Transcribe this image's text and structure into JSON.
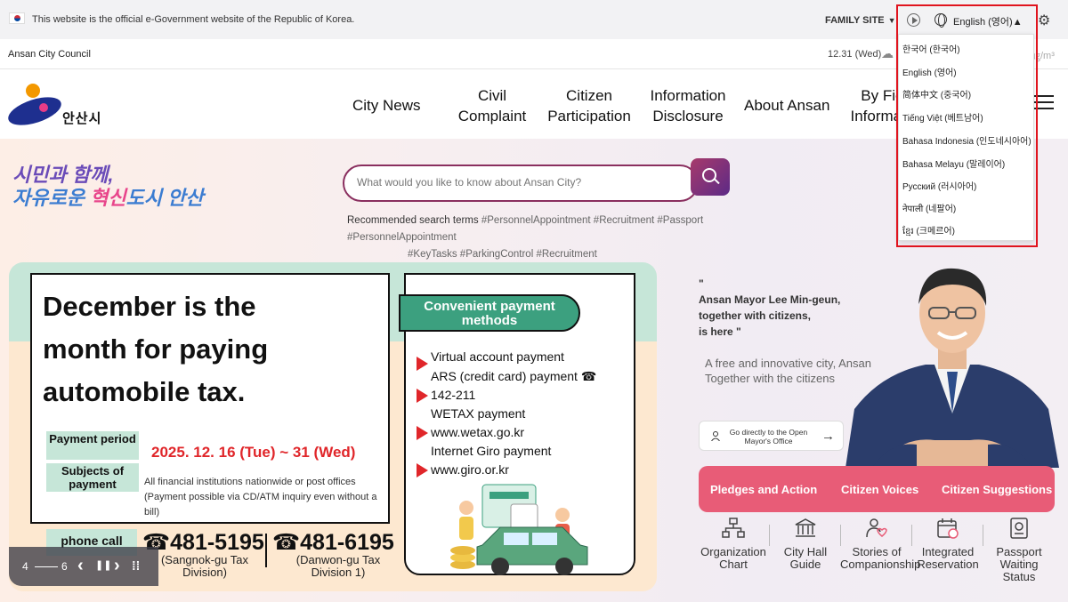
{
  "govbar": {
    "notice": "This website is the official e-Government website of the Republic of Korea.",
    "family_site": "FAMILY SITE",
    "family_arrow": "▼",
    "language": "English (영어)",
    "language_arrow": "▲"
  },
  "councilbar": {
    "council": "Ansan City Council",
    "date": "12.31 (Wed)",
    "unit": "㎍/m³"
  },
  "logo": {
    "name": "안산시"
  },
  "nav": [
    {
      "label": "City News"
    },
    {
      "label": "Civil Complaint"
    },
    {
      "label": "Citizen Participation"
    },
    {
      "label": "Information Disclosure"
    },
    {
      "label": "About Ansan"
    },
    {
      "label": "By Field Information"
    }
  ],
  "slogan": {
    "line1": "시민과 함께,",
    "line2a": "자유로운 ",
    "line2b": "혁신",
    "line2c": "도시 안산"
  },
  "search": {
    "placeholder": "What would you like to know about Ansan City?",
    "recommended_label": "Recommended search terms",
    "tags_row1": "#PersonnelAppointment #Recruitment #Passport #PersonnelAppointment",
    "tags_row2": "#KeyTasks #ParkingControl #Recruitment"
  },
  "banner": {
    "title_l1": "December is the",
    "title_l2": "month for paying",
    "title_l3": "automobile tax.",
    "period_label": "Payment period",
    "period_value": "2025. 12. 16 (Tue) ~ 31 (Wed)",
    "subjects_label": "Subjects of payment",
    "subjects_note": "All financial institutions nationwide or post offices (Payment possible via CD/ATM inquiry even without a bill)",
    "phone_label": "phone call",
    "phone1": "☎481-5195",
    "phone1_sub": "(Sangnok-gu Tax Division)",
    "phone2": "☎481-6195",
    "phone2_sub": "(Danwon-gu Tax Division 1)",
    "methods_title": "Convenient payment methods",
    "methods": [
      "Virtual account payment",
      "ARS (credit card) payment ☎",
      "142-211",
      "WETAX payment",
      "www.wetax.go.kr",
      "Internet Giro payment",
      "www.giro.or.kr"
    ]
  },
  "slider": {
    "current": "4",
    "total": "6",
    "prev": "‹",
    "pause": "❚❚",
    "next": "›",
    "grid": "⁞⁞"
  },
  "mayor": {
    "quote_open": "\"",
    "quote_l1": "Ansan Mayor Lee Min-geun,",
    "quote_l2": "together with citizens,",
    "quote_l3": "is here \"",
    "sub_l1": "A free and innovative city, Ansan",
    "sub_l2": "Together with the citizens",
    "office_btn": "Go directly to the Open Mayor's Office",
    "office_arrow": "→"
  },
  "pledge": {
    "items": [
      "Pledges and Action",
      "Citizen Voices",
      "Citizen Suggestions"
    ],
    "color": "#e85c77"
  },
  "quick_links": [
    {
      "label": "Organization Chart",
      "icon": "org-chart-icon"
    },
    {
      "label": "City Hall Guide",
      "icon": "city-hall-icon"
    },
    {
      "label": "Stories of Companionship",
      "icon": "companionship-icon"
    },
    {
      "label": "Integrated Reservation",
      "icon": "calendar-icon"
    },
    {
      "label": "Passport Waiting Status",
      "icon": "passport-icon"
    }
  ],
  "language_options": [
    "한국어 (한국어)",
    "English (영어)",
    "简体中文 (중국어)",
    "Tiếng Việt (베트남어)",
    "Bahasa Indonesia (인도네시아어)",
    "Bahasa Melayu (말레이어)",
    "Русский (러시아어)",
    "नेपाली (네팔어)",
    "ខ្មែរ (크메르어)"
  ]
}
